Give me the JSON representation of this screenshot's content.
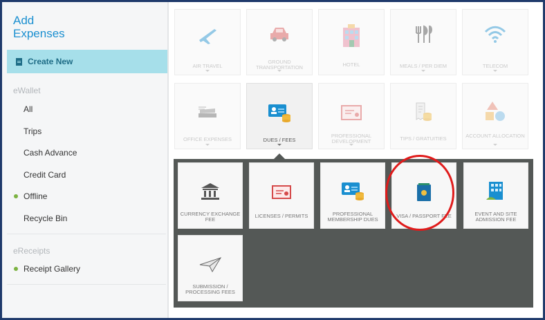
{
  "sidebar": {
    "title": "Add Expenses",
    "create_new": "Create New",
    "ewallet_label": "eWallet",
    "ewallet_items": [
      "All",
      "Trips",
      "Cash Advance",
      "Credit Card",
      "Offline",
      "Recycle Bin"
    ],
    "ereceipts_label": "eReceipts",
    "ereceipt_items": [
      "Receipt Gallery"
    ]
  },
  "categories": [
    {
      "label": "AIR TRAVEL",
      "icon": "airplane-icon"
    },
    {
      "label": "GROUND TRANSPORTATION",
      "icon": "car-icon"
    },
    {
      "label": "HOTEL",
      "icon": "hotel-icon"
    },
    {
      "label": "MEALS / PER DIEM",
      "icon": "utensils-icon"
    },
    {
      "label": "TELECOM",
      "icon": "wifi-icon"
    },
    {
      "label": "OFFICE EXPENSES",
      "icon": "stapler-icon"
    },
    {
      "label": "DUES / FEES",
      "icon": "id-card-coins-icon"
    },
    {
      "label": "PROFESSIONAL DEVELOPMENT",
      "icon": "certificate-icon"
    },
    {
      "label": "TIPS / GRATUITIES",
      "icon": "receipt-coins-icon"
    },
    {
      "label": "ACCOUNT ALLOCATION",
      "icon": "shapes-icon"
    }
  ],
  "subcategories": [
    {
      "label": "CURRENCY EXCHANGE FEE",
      "icon": "bank-icon"
    },
    {
      "label": "LICENSES / PERMITS",
      "icon": "license-icon"
    },
    {
      "label": "PROFESSIONAL MEMBERSHIP DUES",
      "icon": "id-card-coins-icon"
    },
    {
      "label": "VISA / PASSPORT FEE",
      "icon": "passport-icon"
    },
    {
      "label": "EVENT AND SITE ADMISSION FEE",
      "icon": "building-icon"
    },
    {
      "label": "SUBMISSION / PROCESSING FEES",
      "icon": "paper-plane-icon"
    }
  ],
  "colors": {
    "accent": "#1a8fd0",
    "active_bg": "#a6dfea",
    "panel": "#545856",
    "highlight": "#e01b1b",
    "status_dot": "#7cb342"
  }
}
